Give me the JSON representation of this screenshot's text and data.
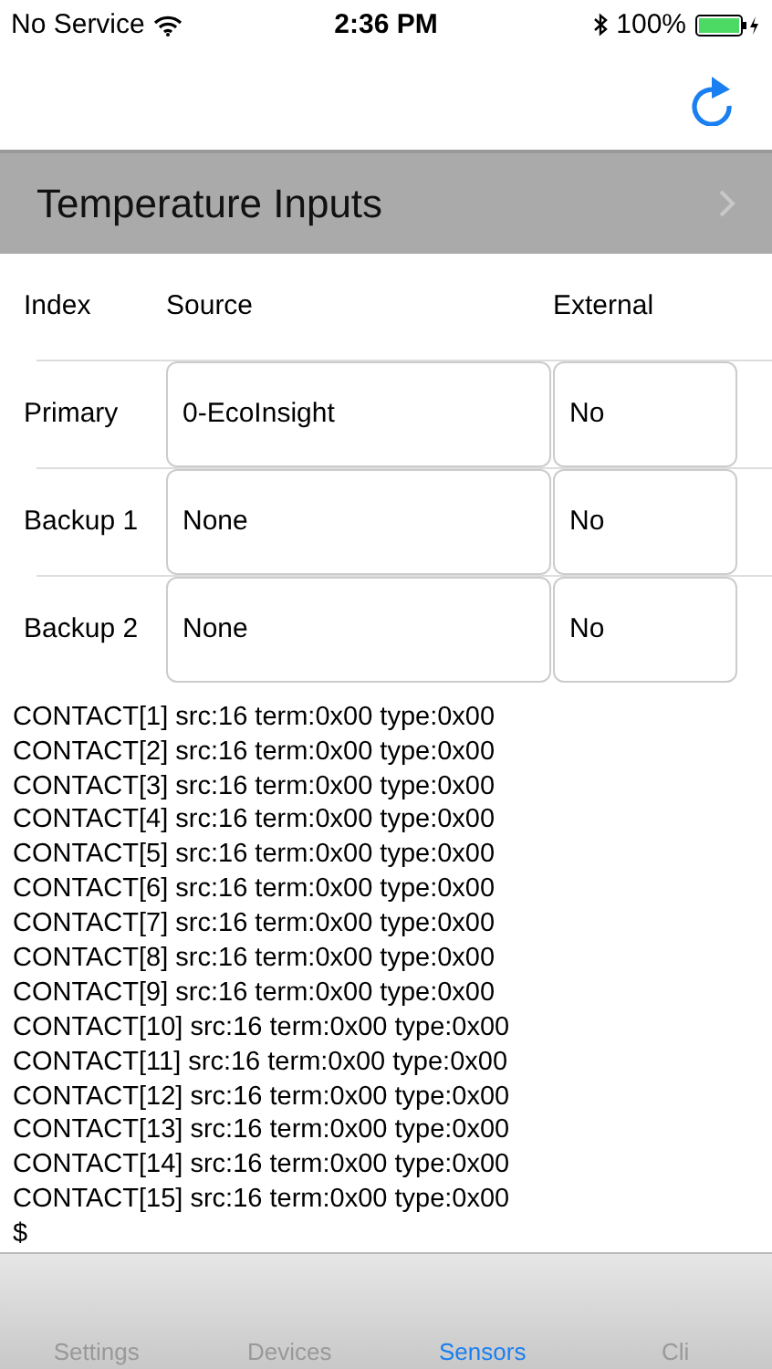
{
  "status_bar": {
    "carrier": "No Service",
    "time": "2:36 PM",
    "battery": "100%"
  },
  "section": {
    "title": "Temperature Inputs"
  },
  "table": {
    "columns": [
      "Index",
      "Source",
      "External"
    ],
    "rows": [
      {
        "index": "Primary",
        "source": "0-EcoInsight",
        "external": "No"
      },
      {
        "index": "Backup 1",
        "source": "None",
        "external": "No"
      },
      {
        "index": "Backup 2",
        "source": "None",
        "external": "No"
      }
    ]
  },
  "console": {
    "lines": [
      "CONTACT[1] src:16 term:0x00 type:0x00",
      "CONTACT[2] src:16 term:0x00 type:0x00",
      "CONTACT[3] src:16 term:0x00 type:0x00",
      "CONTACT[4] src:16 term:0x00 type:0x00",
      "CONTACT[5] src:16 term:0x00 type:0x00",
      "CONTACT[6] src:16 term:0x00 type:0x00",
      "CONTACT[7] src:16 term:0x00 type:0x00",
      "CONTACT[8] src:16 term:0x00 type:0x00",
      "CONTACT[9] src:16 term:0x00 type:0x00",
      "CONTACT[10] src:16 term:0x00 type:0x00",
      "CONTACT[11] src:16 term:0x00 type:0x00",
      "CONTACT[12] src:16 term:0x00 type:0x00",
      "CONTACT[13] src:16 term:0x00 type:0x00",
      "CONTACT[14] src:16 term:0x00 type:0x00",
      "CONTACT[15] src:16 term:0x00 type:0x00",
      "$"
    ]
  },
  "tabs": [
    {
      "label": "Settings",
      "selected": false
    },
    {
      "label": "Devices",
      "selected": false
    },
    {
      "label": "Sensors",
      "selected": true
    },
    {
      "label": "Cli",
      "selected": false
    }
  ]
}
